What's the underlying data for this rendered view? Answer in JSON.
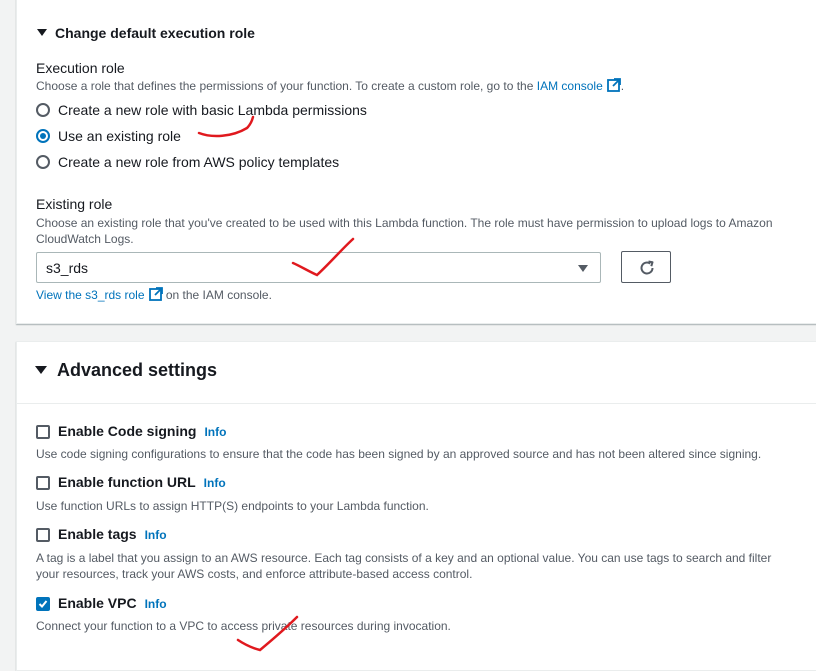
{
  "execution_role_section": {
    "expander_label": "Change default execution role",
    "field_label": "Execution role",
    "description_prefix": "Choose a role that defines the permissions of your function. To create a custom role, go to the ",
    "iam_console_link": "IAM console",
    "description_suffix": ".",
    "options": [
      {
        "label": "Create a new role with basic Lambda permissions",
        "selected": false
      },
      {
        "label": "Use an existing role",
        "selected": true
      },
      {
        "label": "Create a new role from AWS policy templates",
        "selected": false
      }
    ]
  },
  "existing_role": {
    "label": "Existing role",
    "description": "Choose an existing role that you've created to be used with this Lambda function. The role must have permission to upload logs to Amazon CloudWatch Logs.",
    "selected_value": "s3_rds",
    "view_link": "View the s3_rds role",
    "view_link_suffix": " on the IAM console."
  },
  "advanced_settings": {
    "title": "Advanced settings",
    "info_label": "Info",
    "options": [
      {
        "label": "Enable Code signing",
        "checked": false,
        "description": "Use code signing configurations to ensure that the code has been signed by an approved source and has not been altered since signing."
      },
      {
        "label": "Enable function URL",
        "checked": false,
        "description": "Use function URLs to assign HTTP(S) endpoints to your Lambda function."
      },
      {
        "label": "Enable tags",
        "checked": false,
        "description_line1": "A tag is a label that you assign to an AWS resource. Each tag consists of a key and an optional value. You can use tags to search and filter",
        "description_line2": "your resources, track your AWS costs, and enforce attribute-based access control."
      },
      {
        "label": "Enable VPC",
        "checked": true,
        "description": "Connect your function to a VPC to access private resources during invocation."
      }
    ]
  },
  "icons": {
    "expander": "caret-down-icon",
    "external_link": "external-link-icon",
    "refresh": "refresh-icon",
    "checkmark": "checkmark-icon"
  },
  "colors": {
    "link": "#0073bb",
    "text": "#16191f",
    "muted": "#545b64",
    "annotation": "#e0191e"
  }
}
